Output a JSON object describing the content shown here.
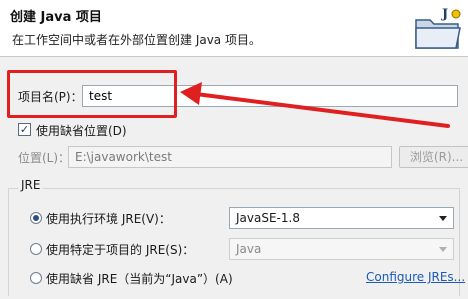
{
  "header": {
    "title": "创建 Java 项目",
    "description": "在工作空间中或者在外部位置创建 Java 项目。"
  },
  "project_name": {
    "label": "项目名(P)：",
    "value": "test"
  },
  "use_default_location": {
    "label": "使用缺省位置(D)",
    "checked": true
  },
  "location": {
    "label": "位置(L)：",
    "value": "E:\\javawork\\test",
    "browse_label": "浏览(R)..."
  },
  "jre": {
    "group_label": "JRE",
    "options": [
      {
        "label": "使用执行环境 JRE(V)：",
        "selected": true,
        "select_value": "JavaSE-1.8"
      },
      {
        "label": "使用特定于项目的 JRE(S)：",
        "selected": false,
        "select_value": "Java"
      },
      {
        "label": "使用缺省 JRE（当前为“Java”）(A)",
        "selected": false
      }
    ],
    "configure_link": "Configure JREs..."
  },
  "colors": {
    "annotation": "#e02020",
    "link": "#1c5ab5"
  }
}
